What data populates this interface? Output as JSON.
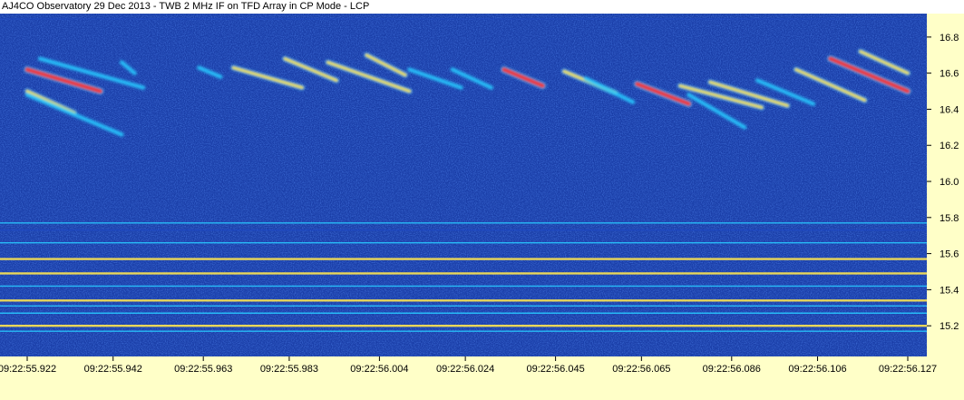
{
  "window_title": "AJ4CO Observatory 29 Dec 2013 - TWB 2 MHz IF on TFD Array in CP Mode - LCP",
  "colors": {
    "background": "#1a3ea8",
    "axis_panel": "#ffffc8",
    "low": "#1d48c8",
    "mid": "#28c8ff",
    "high": "#ffe650",
    "peak": "#ff3030"
  },
  "chart_data": {
    "type": "heatmap",
    "title": "AJ4CO Observatory 29 Dec 2013 - TWB 2 MHz IF on TFD Array in CP Mode - LCP",
    "xlabel": "",
    "ylabel": "",
    "x_tick_labels": [
      "09:22:55.922",
      "09:22:55.942",
      "09:22:55.963",
      "09:22:55.983",
      "09:22:56.004",
      "09:22:56.024",
      "09:22:56.045",
      "09:22:56.065",
      "09:22:56.086",
      "09:22:56.106",
      "09:22:56.127"
    ],
    "y_tick_labels": [
      "16.8",
      "16.6",
      "16.4",
      "16.2",
      "16.0",
      "15.8",
      "15.6",
      "15.4",
      "15.2"
    ],
    "y_ticks": [
      16.8,
      16.6,
      16.4,
      16.2,
      16.0,
      15.8,
      15.6,
      15.4,
      15.2
    ],
    "ylim": [
      15.03,
      16.93
    ],
    "xlim": [
      "09:22:55.922",
      "09:22:56.127"
    ],
    "grid": false,
    "emission_streaks": [
      {
        "t_start": "09:22:55.922",
        "t_end": "09:22:55.939",
        "f_start": 16.62,
        "f_end": 16.5,
        "intensity": "peak"
      },
      {
        "t_start": "09:22:55.922",
        "t_end": "09:22:55.933",
        "f_start": 16.5,
        "f_end": 16.38,
        "intensity": "high"
      },
      {
        "t_start": "09:22:55.922",
        "t_end": "09:22:55.944",
        "f_start": 16.48,
        "f_end": 16.26,
        "intensity": "mid"
      },
      {
        "t_start": "09:22:55.925",
        "t_end": "09:22:55.949",
        "f_start": 16.68,
        "f_end": 16.52,
        "intensity": "mid"
      },
      {
        "t_start": "09:22:55.944",
        "t_end": "09:22:55.947",
        "f_start": 16.66,
        "f_end": 16.6,
        "intensity": "mid"
      },
      {
        "t_start": "09:22:55.962",
        "t_end": "09:22:55.967",
        "f_start": 16.63,
        "f_end": 16.58,
        "intensity": "mid"
      },
      {
        "t_start": "09:22:55.970",
        "t_end": "09:22:55.986",
        "f_start": 16.63,
        "f_end": 16.52,
        "intensity": "high"
      },
      {
        "t_start": "09:22:55.982",
        "t_end": "09:22:55.994",
        "f_start": 16.68,
        "f_end": 16.56,
        "intensity": "high"
      },
      {
        "t_start": "09:22:55.992",
        "t_end": "09:22:56.011",
        "f_start": 16.66,
        "f_end": 16.5,
        "intensity": "high"
      },
      {
        "t_start": "09:22:56.001",
        "t_end": "09:22:56.010",
        "f_start": 16.7,
        "f_end": 16.59,
        "intensity": "high"
      },
      {
        "t_start": "09:22:56.011",
        "t_end": "09:22:56.023",
        "f_start": 16.62,
        "f_end": 16.52,
        "intensity": "mid"
      },
      {
        "t_start": "09:22:56.021",
        "t_end": "09:22:56.030",
        "f_start": 16.62,
        "f_end": 16.52,
        "intensity": "mid"
      },
      {
        "t_start": "09:22:56.033",
        "t_end": "09:22:56.042",
        "f_start": 16.62,
        "f_end": 16.53,
        "intensity": "peak"
      },
      {
        "t_start": "09:22:56.047",
        "t_end": "09:22:56.059",
        "f_start": 16.61,
        "f_end": 16.49,
        "intensity": "high"
      },
      {
        "t_start": "09:22:56.052",
        "t_end": "09:22:56.063",
        "f_start": 16.57,
        "f_end": 16.44,
        "intensity": "mid"
      },
      {
        "t_start": "09:22:56.064",
        "t_end": "09:22:56.076",
        "f_start": 16.54,
        "f_end": 16.43,
        "intensity": "peak"
      },
      {
        "t_start": "09:22:56.074",
        "t_end": "09:22:56.093",
        "f_start": 16.53,
        "f_end": 16.41,
        "intensity": "high"
      },
      {
        "t_start": "09:22:56.076",
        "t_end": "09:22:56.089",
        "f_start": 16.48,
        "f_end": 16.3,
        "intensity": "mid"
      },
      {
        "t_start": "09:22:56.081",
        "t_end": "09:22:56.099",
        "f_start": 16.55,
        "f_end": 16.42,
        "intensity": "high"
      },
      {
        "t_start": "09:22:56.092",
        "t_end": "09:22:56.105",
        "f_start": 16.56,
        "f_end": 16.43,
        "intensity": "mid"
      },
      {
        "t_start": "09:22:56.101",
        "t_end": "09:22:56.117",
        "f_start": 16.62,
        "f_end": 16.45,
        "intensity": "high"
      },
      {
        "t_start": "09:22:56.109",
        "t_end": "09:22:56.127",
        "f_start": 16.68,
        "f_end": 16.5,
        "intensity": "peak"
      },
      {
        "t_start": "09:22:56.116",
        "t_end": "09:22:56.127",
        "f_start": 16.72,
        "f_end": 16.6,
        "intensity": "high"
      }
    ],
    "interference_lines": [
      {
        "freq": 15.77,
        "intensity": "mid"
      },
      {
        "freq": 15.73,
        "intensity": "low"
      },
      {
        "freq": 15.66,
        "intensity": "mid"
      },
      {
        "freq": 15.57,
        "intensity": "high"
      },
      {
        "freq": 15.49,
        "intensity": "high"
      },
      {
        "freq": 15.42,
        "intensity": "mid"
      },
      {
        "freq": 15.34,
        "intensity": "high"
      },
      {
        "freq": 15.31,
        "intensity": "mid"
      },
      {
        "freq": 15.27,
        "intensity": "mid"
      },
      {
        "freq": 15.2,
        "intensity": "high"
      },
      {
        "freq": 15.17,
        "intensity": "mid"
      },
      {
        "freq": 16.9,
        "intensity": "low"
      }
    ]
  }
}
